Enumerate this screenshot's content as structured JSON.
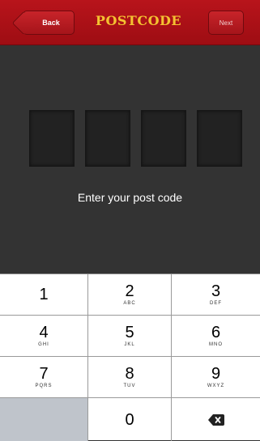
{
  "nav": {
    "back_label": "Back",
    "title": "POSTCODE",
    "next_label": "Next"
  },
  "main": {
    "prompt": "Enter your post code"
  },
  "keypad": {
    "keys": [
      {
        "num": "1",
        "letters": ""
      },
      {
        "num": "2",
        "letters": "ABC"
      },
      {
        "num": "3",
        "letters": "DEF"
      },
      {
        "num": "4",
        "letters": "GHI"
      },
      {
        "num": "5",
        "letters": "JKL"
      },
      {
        "num": "6",
        "letters": "MNO"
      },
      {
        "num": "7",
        "letters": "PQRS"
      },
      {
        "num": "8",
        "letters": "TUV"
      },
      {
        "num": "9",
        "letters": "WXYZ"
      },
      {
        "num": "0",
        "letters": ""
      }
    ],
    "delete_icon": "backspace-icon"
  },
  "colors": {
    "nav_red": "#a5141a",
    "title_gold": "#f4c231",
    "background_dark": "#333333"
  }
}
